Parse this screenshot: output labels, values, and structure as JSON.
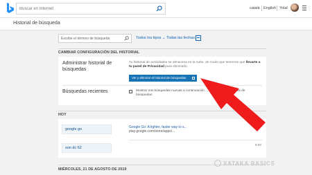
{
  "header": {
    "search_placeholder": "Buscar en Internet",
    "lang_catala": "català",
    "lang_english": "English",
    "user_name": "Yolal"
  },
  "page": {
    "title": "Historial de búsqueda"
  },
  "filters": {
    "search_placeholder": "Escribe el término de búsqueda",
    "type_dropdown": "Todos los tipos ⌄",
    "date_dropdown": "Todas las fechas"
  },
  "settings": {
    "section_title": "CAMBIAR CONFIGURACIÓN DEL HISTORIAL",
    "manage_label": "Administrar historial de búsquedas",
    "manage_desc_prefix": "Tu historial de actividades se almacena en la nube, de modo que tenemos que ",
    "manage_desc_bold": "llevarte a tu panel de Privacidad",
    "manage_desc_suffix": " para eliminarlo.",
    "manage_button": "Ver y eliminar el historial de búsquedas",
    "recent_label": "Búsquedas recientes",
    "recent_checkbox_label": "Mostrar mis búsquedas nuevas a continuación ... ... en las sugerencias de búsquedas"
  },
  "history": {
    "today_title": "HOY",
    "items": [
      {
        "query": "google go",
        "result_title": "Google Go: A lighter, faster way to s...",
        "result_url": "play.google.com/store/apps/...",
        "time": "10:"
      },
      {
        "query": "son dc 62",
        "time": "9:09"
      }
    ],
    "next_date_title": "MIÉRCOLES, 21 DE AGOSTO DE 2019"
  },
  "watermark": {
    "text": "XATAKA BASICS"
  },
  "colors": {
    "accent": "#1673b5",
    "link": "#0c63b5",
    "arrow": "#ee1c1c",
    "bing_logo": "#258ffa"
  }
}
